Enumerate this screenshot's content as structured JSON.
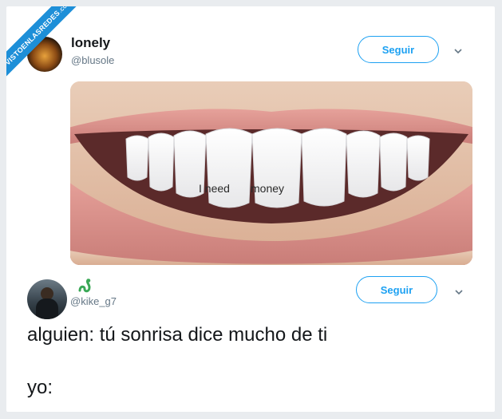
{
  "watermark": {
    "label": "VISTOENLASREDES",
    "suffix": ".COM"
  },
  "tweet1": {
    "name": "lonely",
    "handle": "@blusole",
    "follow_label": "Seguir",
    "image_text": [
      "I need",
      "money"
    ]
  },
  "tweet2": {
    "handle": "@kike_g7",
    "follow_label": "Seguir",
    "lines": [
      "alguien: tú sonrisa dice mucho de ti",
      "yo:"
    ]
  },
  "colors": {
    "accent": "#1da1f2",
    "ribbon": "#1d8fd8",
    "muted": "#657786"
  }
}
